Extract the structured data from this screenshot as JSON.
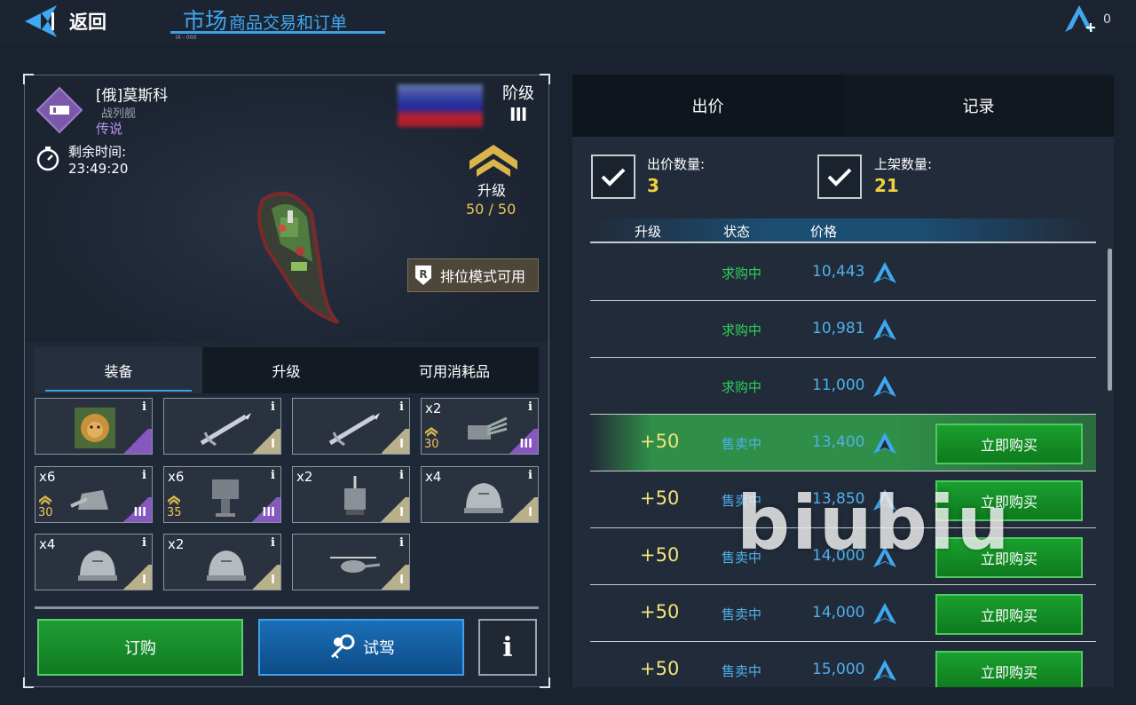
{
  "header": {
    "back_label": "返回",
    "title_main": "市场",
    "title_sub": "商品交易和订单",
    "title_tiny": "IX - 000",
    "currency_count": "0"
  },
  "ship": {
    "name": "[俄]莫斯科",
    "type": "战列舰",
    "rarity": "传说",
    "timer_label": "剩余时间:",
    "timer_value": "23:49:20",
    "tier_label": "阶级",
    "tier_value": "III",
    "upgrade_label": "升级",
    "upgrade_value": "50 / 50",
    "ranked_label": "排位模式可用"
  },
  "tabs": [
    {
      "label": "装备"
    },
    {
      "label": "升级"
    },
    {
      "label": "可用消耗品"
    }
  ],
  "equipment": [
    {
      "kind": "lion-emblem",
      "count": "",
      "level": "",
      "tier": "",
      "tier_class": "tier-t3"
    },
    {
      "kind": "missile",
      "count": "",
      "level": "",
      "tier": "I",
      "tier_class": "tier-t1"
    },
    {
      "kind": "missile",
      "count": "",
      "level": "",
      "tier": "I",
      "tier_class": "tier-t1"
    },
    {
      "kind": "main-turret",
      "count": "x2",
      "level": "30",
      "tier": "III",
      "tier_class": "tier-t3"
    },
    {
      "kind": "gun-turret",
      "count": "x6",
      "level": "30",
      "tier": "III",
      "tier_class": "tier-t3"
    },
    {
      "kind": "ciws",
      "count": "x6",
      "level": "35",
      "tier": "III",
      "tier_class": "tier-t3"
    },
    {
      "kind": "radar-mount",
      "count": "x2",
      "level": "",
      "tier": "I",
      "tier_class": "tier-t1"
    },
    {
      "kind": "dome-turret",
      "count": "x4",
      "level": "",
      "tier": "I",
      "tier_class": "tier-t1"
    },
    {
      "kind": "dome-turret",
      "count": "x4",
      "level": "",
      "tier": "I",
      "tier_class": "tier-t1"
    },
    {
      "kind": "dome-turret",
      "count": "x2",
      "level": "",
      "tier": "I",
      "tier_class": "tier-t1"
    },
    {
      "kind": "helicopter",
      "count": "",
      "level": "",
      "tier": "I",
      "tier_class": "tier-t1"
    }
  ],
  "buttons": {
    "order": "订购",
    "test_drive": "试驾",
    "info": "i"
  },
  "market": {
    "tab_bid": "出价",
    "tab_record": "记录",
    "bid_count_label": "出价数量:",
    "bid_count_value": "3",
    "listing_count_label": "上架数量:",
    "listing_count_value": "21",
    "col_upgrade": "升级",
    "col_status": "状态",
    "col_price": "价格",
    "rows": [
      {
        "upgrade": "",
        "status": "求购中",
        "status_color": "#2fd05a",
        "price": "10,443",
        "buy": ""
      },
      {
        "upgrade": "",
        "status": "求购中",
        "status_color": "#2fd05a",
        "price": "10,981",
        "buy": ""
      },
      {
        "upgrade": "",
        "status": "求购中",
        "status_color": "#2fd05a",
        "price": "11,000",
        "buy": ""
      },
      {
        "upgrade": "+50",
        "status": "售卖中",
        "status_color": "#4fb0ea",
        "price": "13,400",
        "buy": "立即购买"
      },
      {
        "upgrade": "+50",
        "status": "售卖中",
        "status_color": "#4fb0ea",
        "price": "13,850",
        "buy": "立即购买"
      },
      {
        "upgrade": "+50",
        "status": "售卖中",
        "status_color": "#4fb0ea",
        "price": "14,000",
        "buy": "立即购买"
      },
      {
        "upgrade": "+50",
        "status": "售卖中",
        "status_color": "#4fb0ea",
        "price": "14,000",
        "buy": "立即购买"
      },
      {
        "upgrade": "+50",
        "status": "售卖中",
        "status_color": "#4fb0ea",
        "price": "15,000",
        "buy": "立即购买"
      }
    ]
  },
  "watermark": "biubiu",
  "colors": {
    "accent_blue": "#3fa8f0",
    "gold": "#e8c65a",
    "green": "#2fd05a",
    "legend_purple": "#b694ee"
  }
}
